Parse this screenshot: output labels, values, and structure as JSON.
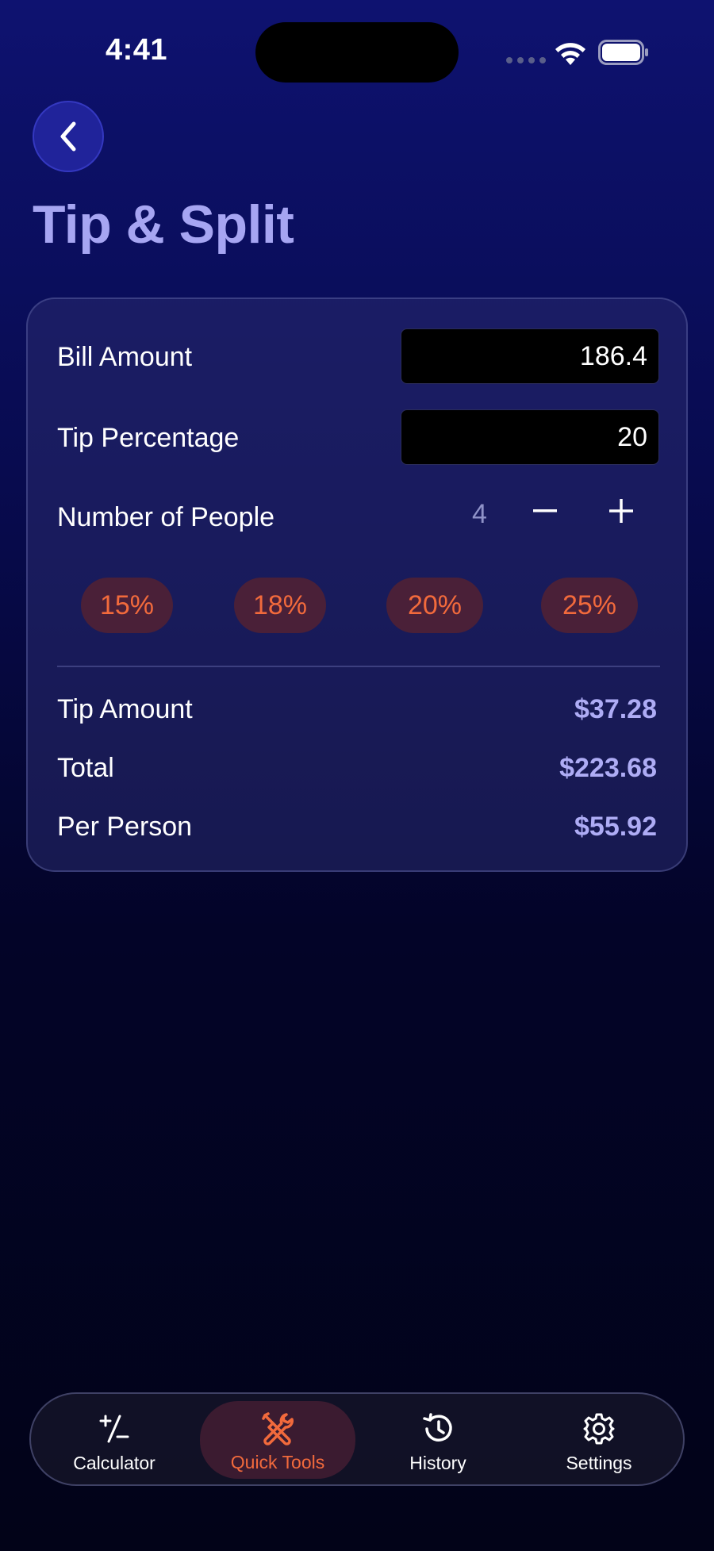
{
  "status_bar": {
    "time": "4:41"
  },
  "header": {
    "title": "Tip & Split"
  },
  "form": {
    "bill_label": "Bill Amount",
    "bill_value": "186.4",
    "tip_label": "Tip Percentage",
    "tip_value": "20",
    "people_label": "Number of People",
    "people_count": "4",
    "decrement_symbol": "−",
    "increment_symbol": "+"
  },
  "presets": [
    "15%",
    "18%",
    "20%",
    "25%"
  ],
  "results": {
    "tip_amount_label": "Tip Amount",
    "tip_amount_value": "$37.28",
    "total_label": "Total",
    "total_value": "$223.68",
    "per_person_label": "Per Person",
    "per_person_value": "$55.92"
  },
  "tab_bar": {
    "tabs": [
      {
        "label": "Calculator",
        "icon": "plus-minus-icon"
      },
      {
        "label": "Quick Tools",
        "icon": "tools-icon",
        "active": true
      },
      {
        "label": "History",
        "icon": "history-icon"
      },
      {
        "label": "Settings",
        "icon": "gear-icon"
      }
    ]
  },
  "colors": {
    "accent": "#f26a3c",
    "title": "#a6a5f2",
    "result_value": "#aeacf5",
    "background_top": "#0e1270",
    "background_bottom": "#020318"
  }
}
